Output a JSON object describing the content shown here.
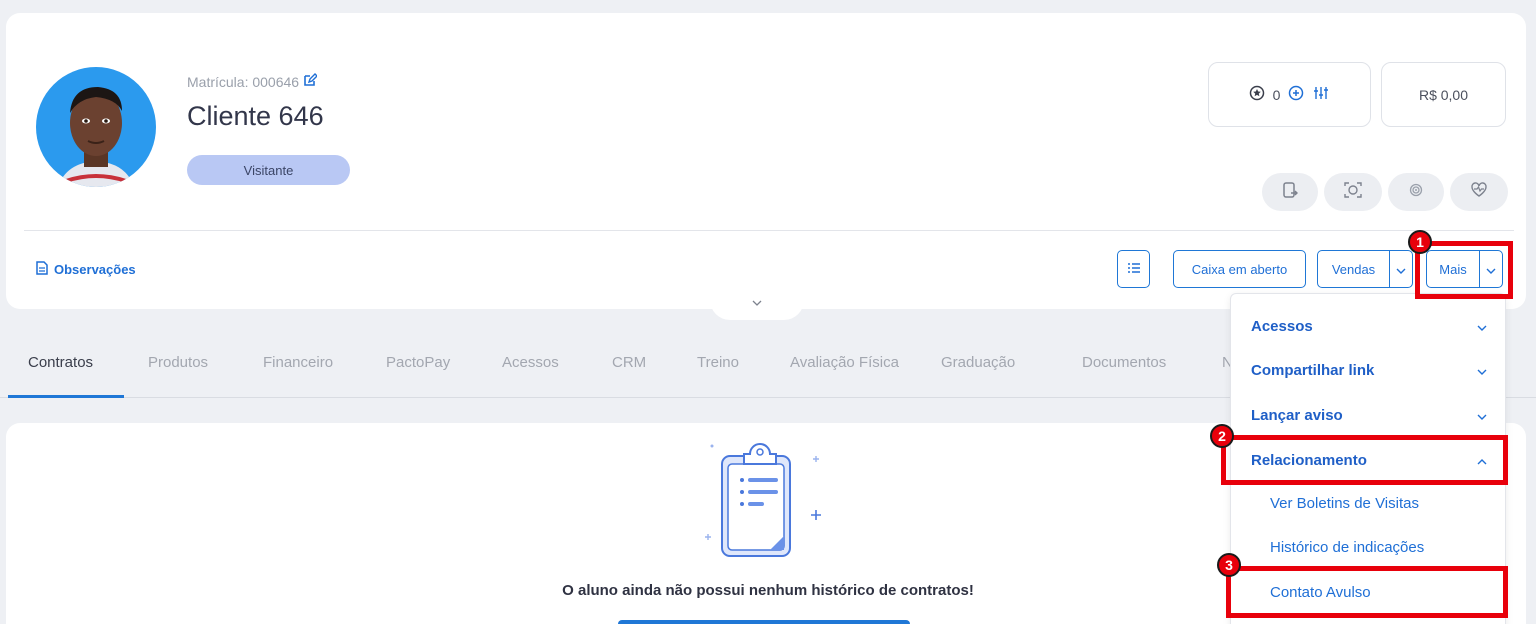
{
  "client": {
    "matricula": "Matrícula: 000646",
    "name": "Cliente 646",
    "status_badge": "Visitante"
  },
  "stats": {
    "points": "0",
    "balance": "R$ 0,00"
  },
  "actions": {
    "observacoes": "Observações",
    "caixa_em_aberto": "Caixa em aberto",
    "vendas": "Vendas",
    "mais": "Mais"
  },
  "tabs": [
    "Contratos",
    "Produtos",
    "Financeiro",
    "PactoPay",
    "Acessos",
    "CRM",
    "Treino",
    "Avaliação Física",
    "Graduação",
    "Documentos",
    "N"
  ],
  "empty_state": {
    "message": "O aluno ainda não possui nenhum histórico de contratos!"
  },
  "dropdown": {
    "acessos": "Acessos",
    "compartilhar_link": "Compartilhar link",
    "lancar_aviso": "Lançar aviso",
    "relacionamento": "Relacionamento",
    "ver_boletins": "Ver Boletins de Visitas",
    "historico_indicacoes": "Histórico de indicações",
    "contato_avulso": "Contato Avulso"
  },
  "markers": [
    "1",
    "2",
    "3"
  ],
  "colors": {
    "accent": "#1f77d6",
    "highlight": "#e8000b",
    "badge": "#b9c8f4"
  }
}
